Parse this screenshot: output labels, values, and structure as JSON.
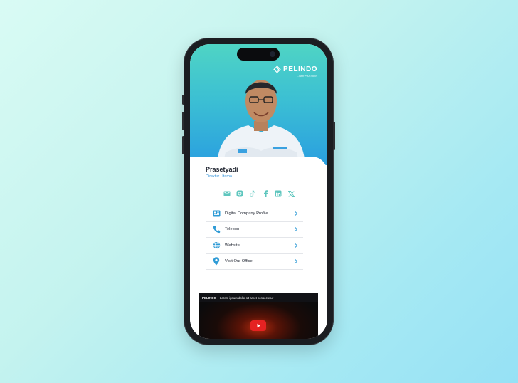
{
  "brand": {
    "name": "PELINDO",
    "tagline": "...with PASSION"
  },
  "profile": {
    "name": "Prasetyadi",
    "role": "Direktur Utama"
  },
  "socials": [
    {
      "icon": "email-icon"
    },
    {
      "icon": "instagram-icon"
    },
    {
      "icon": "tiktok-icon"
    },
    {
      "icon": "facebook-icon"
    },
    {
      "icon": "linkedin-icon"
    },
    {
      "icon": "x-icon"
    }
  ],
  "menu": {
    "items": [
      {
        "label": "Digital Company Profile",
        "icon": "profile-card-icon"
      },
      {
        "label": "Telepon",
        "icon": "phone-icon"
      },
      {
        "label": "Website",
        "icon": "globe-icon"
      },
      {
        "label": "Visit Our Office",
        "icon": "location-pin-icon"
      }
    ]
  },
  "video": {
    "logo": "PELINDO",
    "title": "Lorem ipsum dolor sit amet consectetur"
  },
  "colors": {
    "accent": "#2b8fd8",
    "teal": "#4fd4c4",
    "icon": "#2f9bd6",
    "social": "#5ec6be"
  }
}
